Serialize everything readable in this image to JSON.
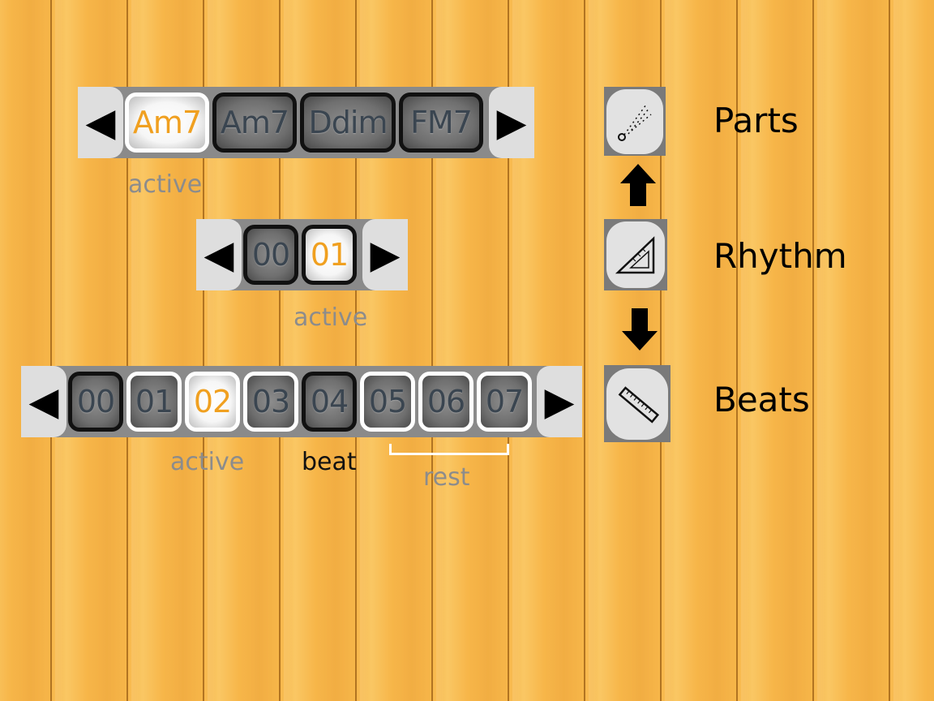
{
  "parts_bar": {
    "prev_arrow": "◀",
    "next_arrow": "▶",
    "cells": [
      {
        "label": "Am7",
        "state": "active"
      },
      {
        "label": "Am7",
        "state": "normal"
      },
      {
        "label": "Ddim",
        "state": "normal"
      },
      {
        "label": "FM7",
        "state": "normal"
      }
    ],
    "caption": "active"
  },
  "rhythm_bar": {
    "prev_arrow": "◀",
    "next_arrow": "▶",
    "cells": [
      {
        "label": "00",
        "state": "normal"
      },
      {
        "label": "01",
        "state": "active"
      }
    ],
    "caption": "active"
  },
  "beats_bar": {
    "prev_arrow": "◀",
    "next_arrow": "▶",
    "cells": [
      {
        "label": "00",
        "state": "beat"
      },
      {
        "label": "01",
        "state": "rest"
      },
      {
        "label": "02",
        "state": "active"
      },
      {
        "label": "03",
        "state": "rest"
      },
      {
        "label": "04",
        "state": "beat"
      },
      {
        "label": "05",
        "state": "rest"
      },
      {
        "label": "06",
        "state": "rest"
      },
      {
        "label": "07",
        "state": "rest"
      }
    ],
    "captions": {
      "active": "active",
      "beat": "beat",
      "rest": "rest"
    }
  },
  "modes": {
    "parts": {
      "label": "Parts",
      "icon": "oboe-icon"
    },
    "rhythm": {
      "label": "Rhythm",
      "icon": "set-square-icon"
    },
    "beats": {
      "label": "Beats",
      "icon": "ruler-icon"
    },
    "arrow_up": "up-arrow-icon",
    "arrow_down": "down-arrow-icon"
  },
  "colors": {
    "active_text": "#f0a020",
    "inactive_text": "#3a4550",
    "caption": "#8c8c8c",
    "wood": "#f7b649"
  }
}
